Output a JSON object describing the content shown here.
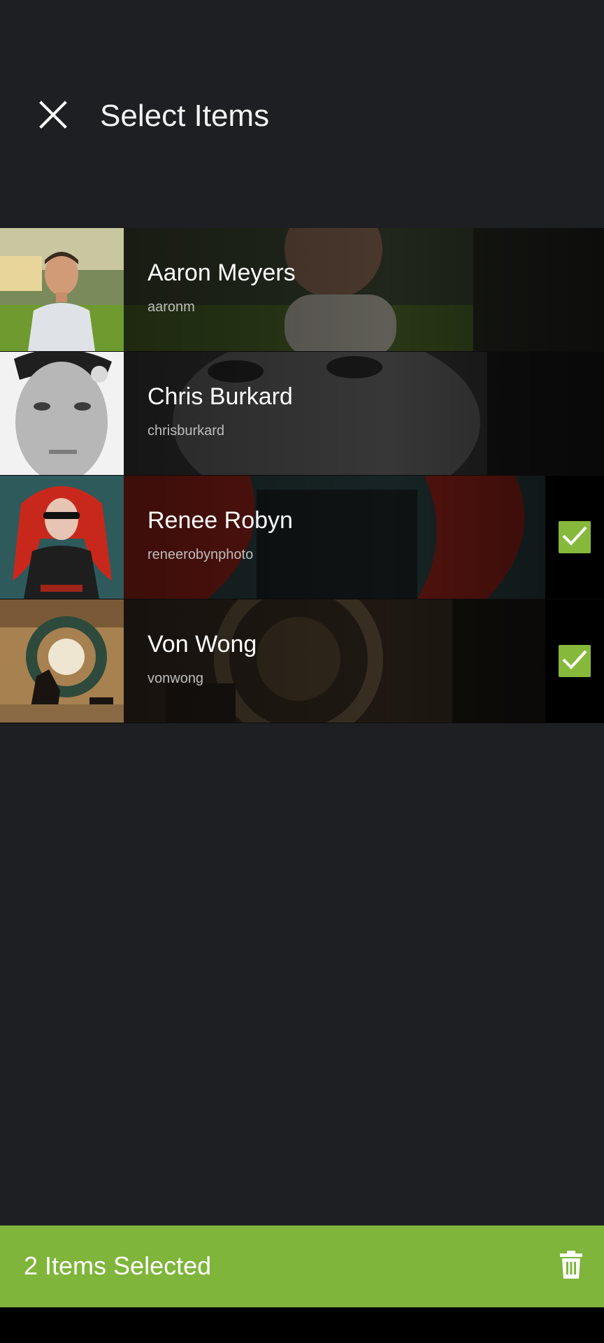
{
  "header": {
    "title": "Select Items",
    "close_icon": "close-icon"
  },
  "items": [
    {
      "name": "Aaron Meyers",
      "handle": "aaronm",
      "selected": false
    },
    {
      "name": "Chris Burkard",
      "handle": "chrisburkard",
      "selected": false
    },
    {
      "name": "Renee Robyn",
      "handle": "reneerobynphoto",
      "selected": true
    },
    {
      "name": "Von Wong",
      "handle": "vonwong",
      "selected": true
    }
  ],
  "footer": {
    "selection_label": "2 Items Selected",
    "delete_icon": "trash-icon"
  },
  "colors": {
    "background": "#1e1f22",
    "accent": "#7eb53a",
    "checkbox": "#86b93b"
  }
}
